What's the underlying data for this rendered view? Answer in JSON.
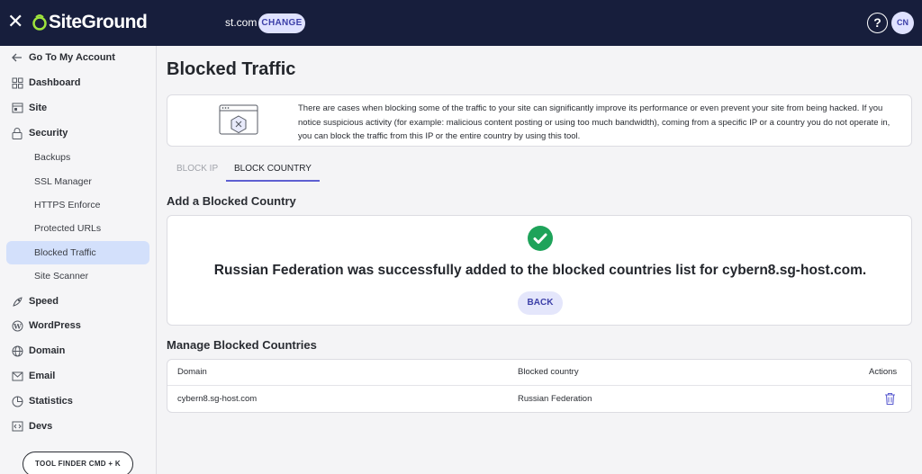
{
  "header": {
    "logo_text": "SiteGround",
    "site_name": "st.com",
    "change_label": "CHANGE",
    "help_label": "?",
    "avatar_initials": "CN"
  },
  "sidebar": {
    "back_label": "Go To My Account",
    "items": [
      {
        "label": "Dashboard",
        "icon": "dashboard-icon"
      },
      {
        "label": "Site",
        "icon": "site-icon"
      },
      {
        "label": "Security",
        "icon": "lock-icon"
      },
      {
        "label": "Speed",
        "icon": "rocket-icon"
      },
      {
        "label": "WordPress",
        "icon": "wordpress-icon"
      },
      {
        "label": "Domain",
        "icon": "globe-icon"
      },
      {
        "label": "Email",
        "icon": "envelope-icon"
      },
      {
        "label": "Statistics",
        "icon": "pie-chart-icon"
      },
      {
        "label": "Devs",
        "icon": "code-icon"
      }
    ],
    "security_sub": [
      "Backups",
      "SSL Manager",
      "HTTPS Enforce",
      "Protected URLs",
      "Blocked Traffic",
      "Site Scanner"
    ],
    "active_sub": "Blocked Traffic",
    "tool_finder_label": "TOOL FINDER CMD + K"
  },
  "main": {
    "title": "Blocked Traffic",
    "info_text": "There are cases when blocking some of the traffic to your site can significantly improve its performance or even prevent your site from being hacked. If you notice suspicious activity (for example: malicious content posting or using too much bandwidth), coming from a specific IP or a country you do not operate in, you can block the traffic from this IP or the entire country by using this tool.",
    "tabs": [
      {
        "label": "BLOCK IP",
        "active": false
      },
      {
        "label": "BLOCK COUNTRY",
        "active": true
      }
    ],
    "add_heading": "Add a Blocked Country",
    "success_message": "Russian Federation was successfully added to the blocked countries list for cybern8.sg-host.com.",
    "back_label": "BACK",
    "manage_heading": "Manage Blocked Countries",
    "table": {
      "columns": [
        "Domain",
        "Blocked country",
        "Actions"
      ],
      "rows": [
        {
          "domain": "cybern8.sg-host.com",
          "country": "Russian Federation"
        }
      ]
    }
  },
  "colors": {
    "topbar": "#171e3c",
    "accent": "#5e5fd1",
    "success": "#1ea35a",
    "active_nav": "#d3e0fb"
  }
}
